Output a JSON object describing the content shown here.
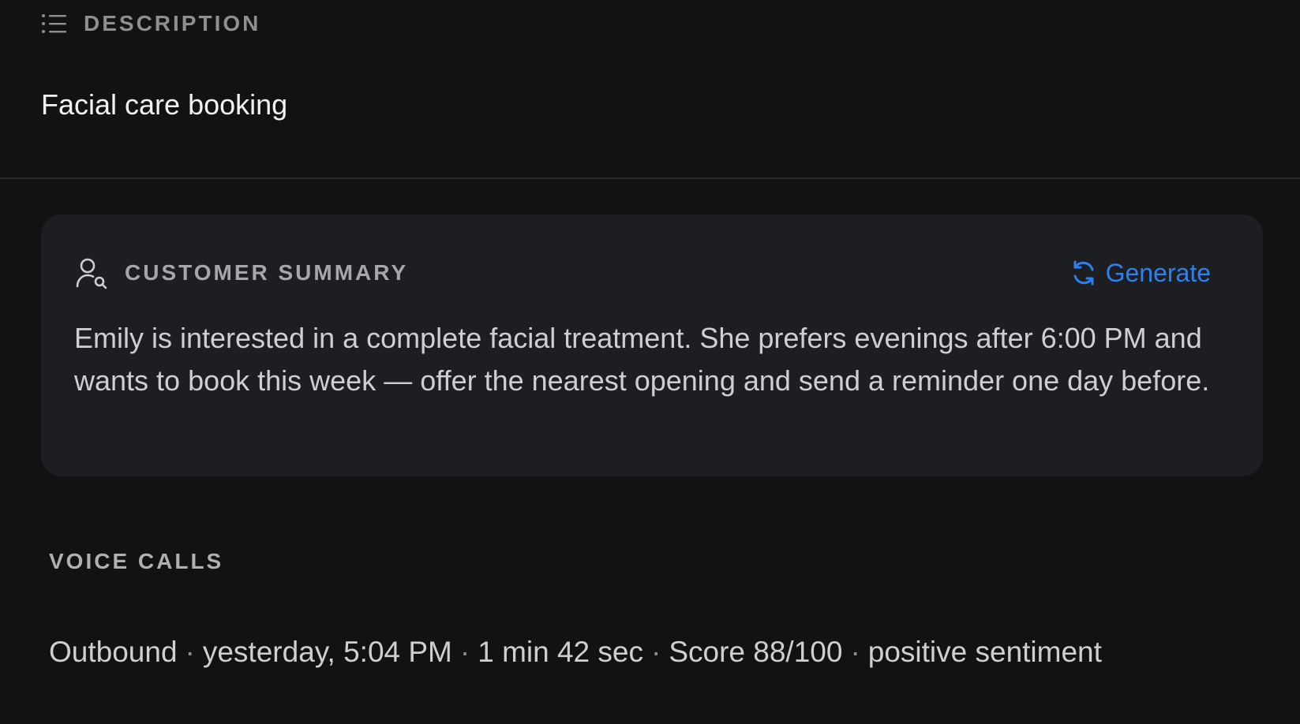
{
  "description": {
    "header_label": "DESCRIPTION",
    "header_icon": "list-icon",
    "text": "Facial care booking"
  },
  "customer_summary": {
    "header_label": "CUSTOMER SUMMARY",
    "header_icon": "user-search-icon",
    "generate_label": "Generate",
    "generate_icon": "refresh-icon",
    "body": "Emily is interested in a complete facial treatment. She prefers evenings after 6:00 PM and wants to book this week — offer the nearest opening and send a reminder one day before."
  },
  "voice_calls": {
    "header_label": "VOICE CALLS",
    "items": [
      {
        "direction": "Outbound",
        "time": "yesterday, 5:04 PM",
        "duration": "1 min 42 sec",
        "score": "Score 88/100",
        "sentiment": "positive sentiment"
      }
    ]
  },
  "colors": {
    "background": "#121212",
    "card": "#1d1e22",
    "accent": "#2f80ed",
    "muted_label": "#8e8e93"
  }
}
